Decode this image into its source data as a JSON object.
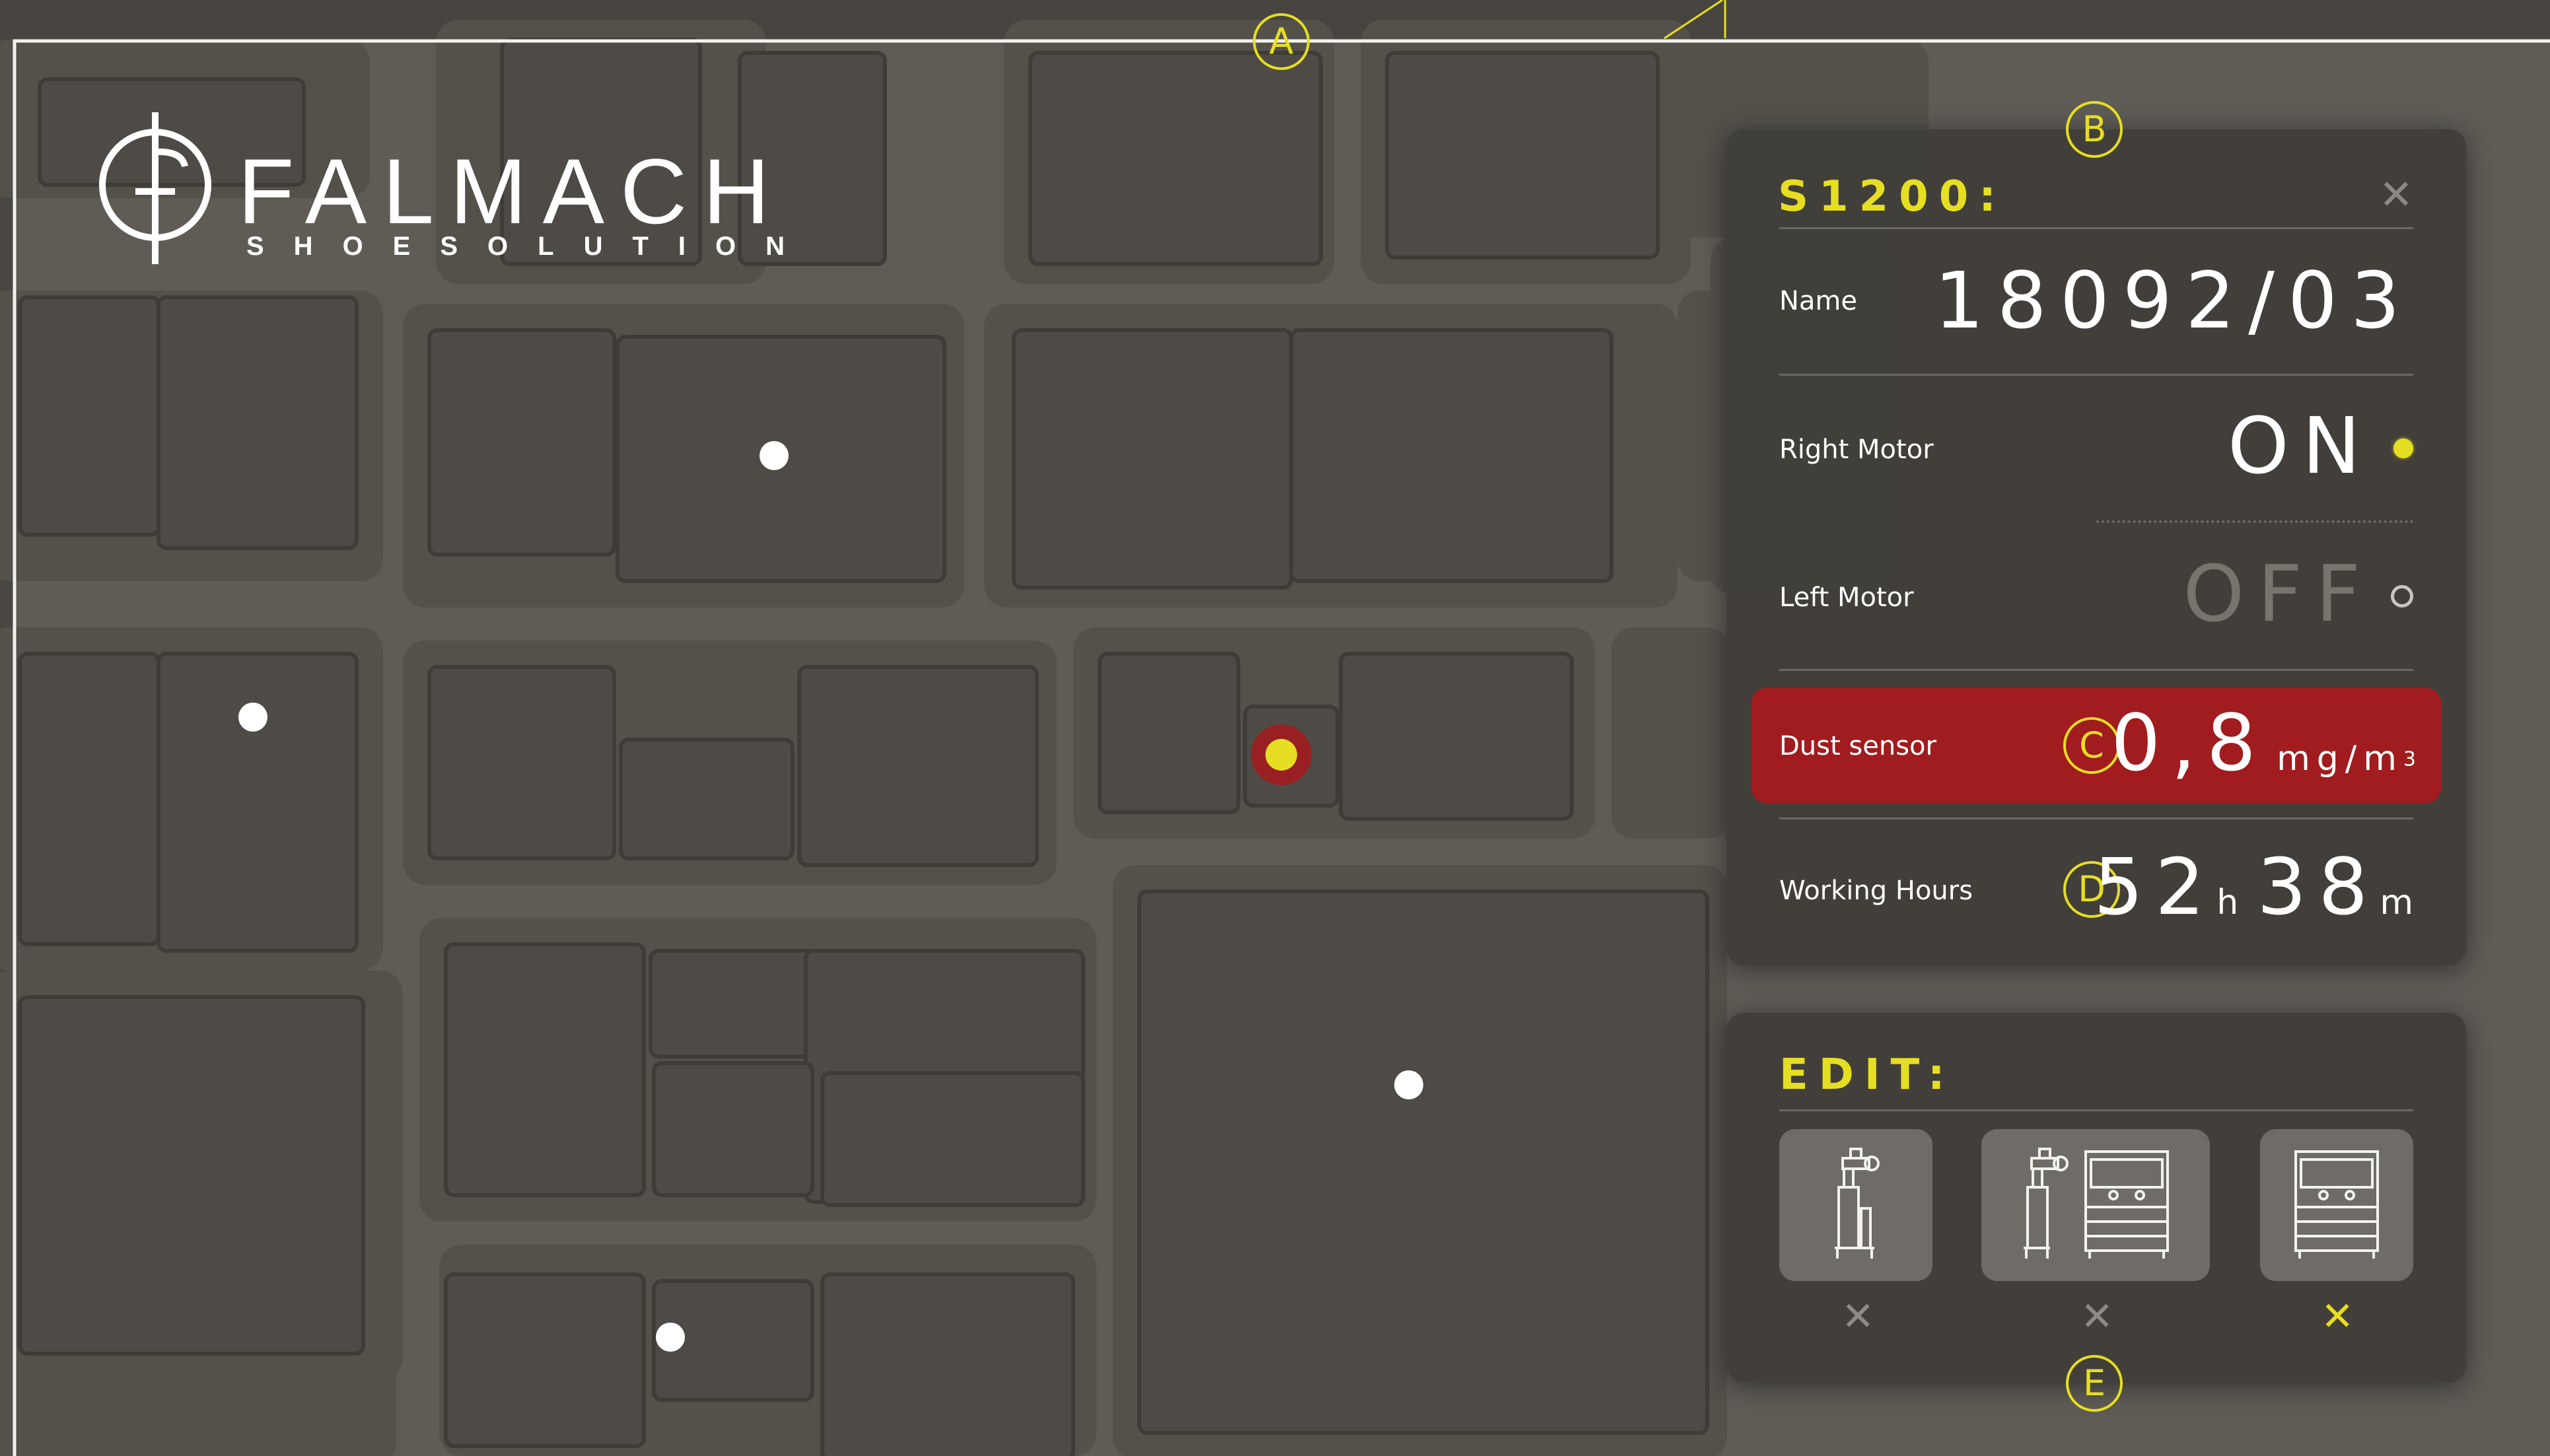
{
  "brand": {
    "name": "FALMACH",
    "tagline": "SHOESOLUTION"
  },
  "markers": {
    "a": "A",
    "b": "B",
    "c": "C",
    "d": "D",
    "e": "E"
  },
  "machine_panel": {
    "title": "S1200:",
    "close_icon": "close-icon",
    "name": {
      "label": "Name",
      "value": "18092/03"
    },
    "right_motor": {
      "label": "Right Motor",
      "value": "ON",
      "state": "on"
    },
    "left_motor": {
      "label": "Left Motor",
      "value": "OFF",
      "state": "off"
    },
    "dust_sensor": {
      "label": "Dust sensor",
      "value": "0,8",
      "unit": "mg/m",
      "unit_sup": "3",
      "alert_color": "#a11c1e"
    },
    "working_hours": {
      "label": "Working Hours",
      "hours": "52",
      "hours_unit": "h",
      "minutes": "38",
      "minutes_unit": "m"
    }
  },
  "edit_panel": {
    "title": "EDIT:",
    "options": [
      {
        "icon": "robot-arm-icon",
        "remove_icon": "close-icon",
        "active": false
      },
      {
        "icon": "robot-arm-and-press-icon",
        "remove_icon": "close-icon",
        "active": false
      },
      {
        "icon": "press-machine-icon",
        "remove_icon": "close-icon",
        "active": true
      }
    ]
  },
  "colors": {
    "accent": "#e6de22",
    "alert": "#a11c1e",
    "map_bg": "#4a4743",
    "road": "#64615b"
  }
}
